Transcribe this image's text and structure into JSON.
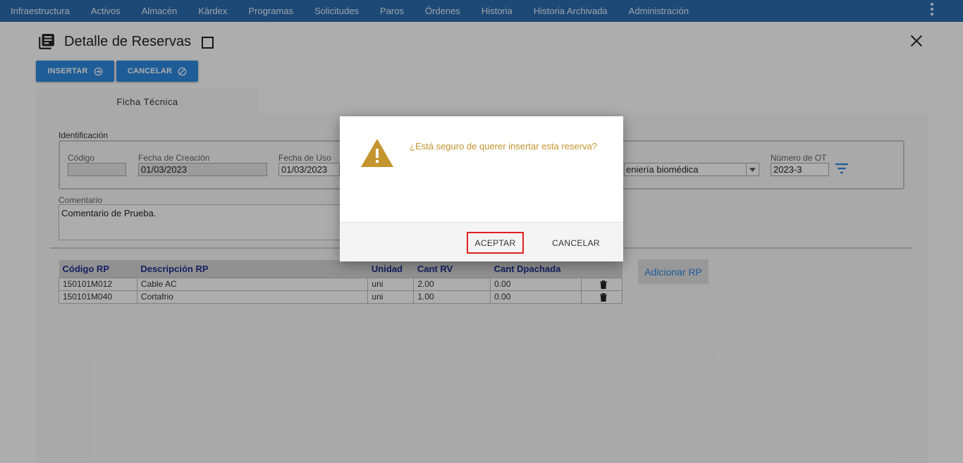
{
  "nav": {
    "items": [
      "Infraestructura",
      "Activos",
      "Almacén",
      "Kárdex",
      "Programas",
      "Solicitudes",
      "Paros",
      "Órdenes",
      "Historia",
      "Historia Archivada",
      "Administración"
    ]
  },
  "header": {
    "title": "Detalle de Reservas",
    "insert_label": "INSERTAR",
    "cancel_label": "CANCELAR"
  },
  "tabs": {
    "active": "Ficha Técnica"
  },
  "identification": {
    "section_label": "Identificación",
    "codigo": {
      "label": "Código",
      "value": ""
    },
    "fecha_creacion": {
      "label": "Fecha de Creación",
      "value": "01/03/2023"
    },
    "fecha_uso": {
      "label": "Fecha de Uso",
      "value": "01/03/2023"
    },
    "area": {
      "value": "eniería biomédica"
    },
    "numero_ot": {
      "label": "Número de OT",
      "value": "2023-3"
    }
  },
  "comment": {
    "label": "Comentario",
    "value": "Comentario de Prueba."
  },
  "table": {
    "headers": [
      "Código RP",
      "Descripción RP",
      "Unidad",
      "Cant RV",
      "Cant Dpachada"
    ],
    "rows": [
      [
        "150101M012",
        "Cable AC",
        "uni",
        "2.00",
        "0.00"
      ],
      [
        "150101M040",
        "Cortafrio",
        "uni",
        "1.00",
        "0.00"
      ]
    ]
  },
  "add_rp_label": "Adicionar RP",
  "modal": {
    "message": "¿Está seguro de querer insertar esta reserva?",
    "accept_label": "ACEPTAR",
    "cancel_label": "CANCELAR"
  },
  "colors": {
    "nav_bg": "#2b6cb0",
    "primary_button": "#2d89e0",
    "table_header_text": "#1f2d8f",
    "warning": "#c4952e",
    "accept_outline": "#e02020"
  }
}
